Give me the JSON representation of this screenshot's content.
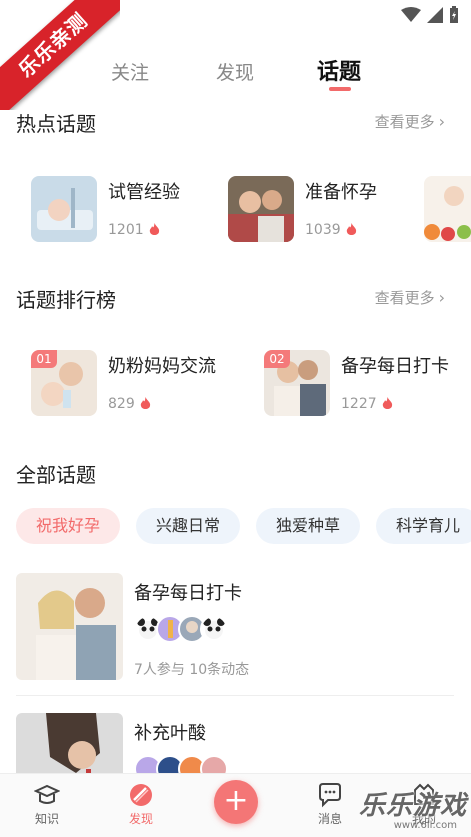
{
  "corner_label": "乐乐亲测",
  "top_tabs": {
    "follow": "关注",
    "discover": "发现",
    "topics": "话题"
  },
  "hot": {
    "title": "热点话题",
    "more": "查看更多",
    "items": [
      {
        "title": "试管经验",
        "count": "1201"
      },
      {
        "title": "准备怀孕",
        "count": "1039"
      }
    ]
  },
  "ranking": {
    "title": "话题排行榜",
    "more": "查看更多",
    "items": [
      {
        "rank": "01",
        "title": "奶粉妈妈交流",
        "count": "829"
      },
      {
        "rank": "02",
        "title": "备孕每日打卡",
        "count": "1227"
      }
    ]
  },
  "all": {
    "title": "全部话题",
    "chips": [
      "祝我好孕",
      "兴趣日常",
      "独爱种草",
      "科学育儿"
    ]
  },
  "list": [
    {
      "title": "备孕每日打卡",
      "meta": "7人参与  10条动态"
    },
    {
      "title": "补充叶酸",
      "meta": ""
    }
  ],
  "nav": {
    "knowledge": "知识",
    "discover": "发现",
    "add": "+",
    "messages": "消息",
    "mine": "我的"
  },
  "watermark": {
    "text": "乐乐游戏",
    "url": "www.6ll.com"
  },
  "colors": {
    "accent": "#f26a6a",
    "chip_bg": "#eef4fb",
    "ribbon": "#d8232a"
  }
}
